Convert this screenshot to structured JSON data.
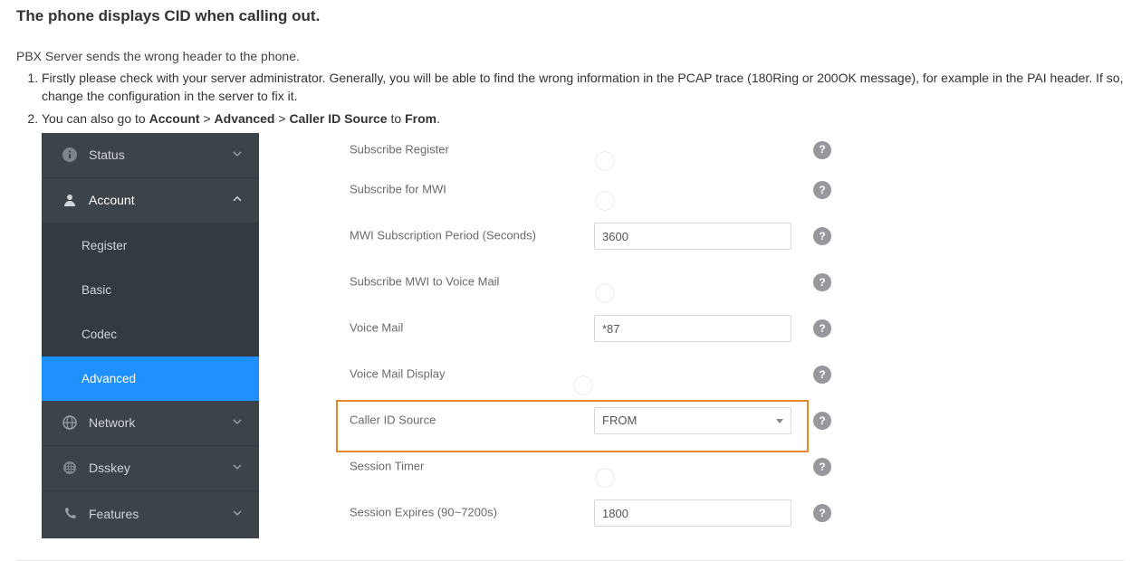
{
  "heading": "The phone displays CID when calling out.",
  "intro": "PBX Server sends the wrong header to the phone.",
  "step1": "Firstly please check with your server administrator. Generally, you will be able to find the wrong information in the PCAP trace (180Ring or 200OK message), for example in the PAI header. If so, change the configuration in the server to fix it.",
  "step2_pre": "You can also go to ",
  "step2_account": "Account",
  "step2_gt1": " > ",
  "step2_advanced": "Advanced",
  "step2_gt2": " > ",
  "step2_cid": "Caller ID Source",
  "step2_to": " to ",
  "step2_from": "From",
  "step2_dot": ".",
  "sidebar": {
    "status": "Status",
    "account": "Account",
    "register": "Register",
    "basic": "Basic",
    "codec": "Codec",
    "advanced": "Advanced",
    "network": "Network",
    "dsskey": "Dsskey",
    "features": "Features"
  },
  "rows": {
    "subreg": {
      "label": "Subscribe Register",
      "state": "OFF"
    },
    "submwi": {
      "label": "Subscribe for MWI",
      "state": "OFF"
    },
    "mwiperiod": {
      "label": "MWI Subscription Period (Seconds)",
      "value": "3600"
    },
    "submwivm": {
      "label": "Subscribe MWI to Voice Mail",
      "state": "OFF"
    },
    "vm": {
      "label": "Voice Mail",
      "value": "*87"
    },
    "vmdisp": {
      "label": "Voice Mail Display",
      "state": "ON"
    },
    "cidsrc": {
      "label": "Caller ID Source",
      "value": "FROM"
    },
    "sesst": {
      "label": "Session Timer",
      "state": "OFF"
    },
    "sessexp": {
      "label": "Session Expires (90~7200s)",
      "value": "1800"
    }
  },
  "help_glyph": "?"
}
